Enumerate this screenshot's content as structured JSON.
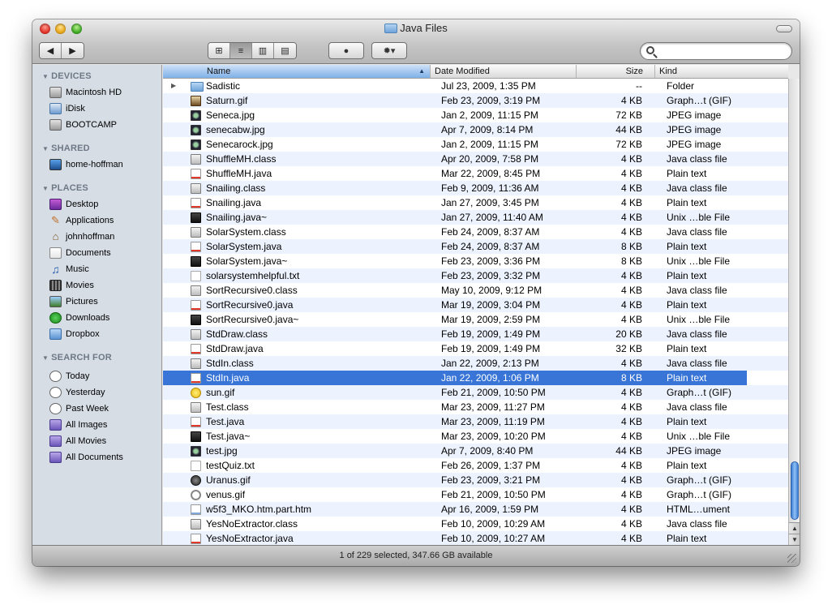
{
  "window": {
    "title": "Java Files"
  },
  "toolbar": {
    "back": "◀",
    "forward": "▶",
    "view_buttons": [
      "⊞",
      "≡",
      "▥",
      "▤"
    ],
    "eye": "●",
    "gear": "✹▾",
    "search_placeholder": ""
  },
  "sidebar": {
    "sections": [
      {
        "title": "DEVICES",
        "items": [
          {
            "label": "Macintosh HD",
            "icon": "disk"
          },
          {
            "label": "iDisk",
            "icon": "idisk"
          },
          {
            "label": "BOOTCAMP",
            "icon": "disk"
          }
        ]
      },
      {
        "title": "SHARED",
        "items": [
          {
            "label": "home-hoffman",
            "icon": "monitor"
          }
        ]
      },
      {
        "title": "PLACES",
        "items": [
          {
            "label": "Desktop",
            "icon": "desk"
          },
          {
            "label": "Applications",
            "icon": "apps"
          },
          {
            "label": "johnhoffman",
            "icon": "home"
          },
          {
            "label": "Documents",
            "icon": "docs"
          },
          {
            "label": "Music",
            "icon": "music"
          },
          {
            "label": "Movies",
            "icon": "movies"
          },
          {
            "label": "Pictures",
            "icon": "pics"
          },
          {
            "label": "Downloads",
            "icon": "dl"
          },
          {
            "label": "Dropbox",
            "icon": "box"
          }
        ]
      },
      {
        "title": "SEARCH FOR",
        "items": [
          {
            "label": "Today",
            "icon": "clock"
          },
          {
            "label": "Yesterday",
            "icon": "clock"
          },
          {
            "label": "Past Week",
            "icon": "clock"
          },
          {
            "label": "All Images",
            "icon": "smart"
          },
          {
            "label": "All Movies",
            "icon": "smart"
          },
          {
            "label": "All Documents",
            "icon": "smart"
          }
        ]
      }
    ]
  },
  "columns": {
    "name": "Name",
    "date": "Date Modified",
    "size": "Size",
    "kind": "Kind"
  },
  "files": [
    {
      "name": "Sadistic",
      "date": "Jul 23, 2009, 1:35 PM",
      "size": "--",
      "kind": "Folder",
      "icon": "folder"
    },
    {
      "name": "Saturn.gif",
      "date": "Feb 23, 2009, 3:19 PM",
      "size": "4 KB",
      "kind": "Graph…t (GIF)",
      "icon": "gif"
    },
    {
      "name": "Seneca.jpg",
      "date": "Jan 2, 2009, 11:15 PM",
      "size": "72 KB",
      "kind": "JPEG image",
      "icon": "jpg"
    },
    {
      "name": "senecabw.jpg",
      "date": "Apr 7, 2009, 8:14 PM",
      "size": "44 KB",
      "kind": "JPEG image",
      "icon": "jpg"
    },
    {
      "name": "Senecarock.jpg",
      "date": "Jan 2, 2009, 11:15 PM",
      "size": "72 KB",
      "kind": "JPEG image",
      "icon": "jpg"
    },
    {
      "name": "ShuffleMH.class",
      "date": "Apr 20, 2009, 7:58 PM",
      "size": "4 KB",
      "kind": "Java class file",
      "icon": "class"
    },
    {
      "name": "ShuffleMH.java",
      "date": "Mar 22, 2009, 8:45 PM",
      "size": "4 KB",
      "kind": "Plain text",
      "icon": "java"
    },
    {
      "name": "Snailing.class",
      "date": "Feb 9, 2009, 11:36 AM",
      "size": "4 KB",
      "kind": "Java class file",
      "icon": "class"
    },
    {
      "name": "Snailing.java",
      "date": "Jan 27, 2009, 3:45 PM",
      "size": "4 KB",
      "kind": "Plain text",
      "icon": "java"
    },
    {
      "name": "Snailing.java~",
      "date": "Jan 27, 2009, 11:40 AM",
      "size": "4 KB",
      "kind": "Unix …ble File",
      "icon": "unix"
    },
    {
      "name": "SolarSystem.class",
      "date": "Feb 24, 2009, 8:37 AM",
      "size": "4 KB",
      "kind": "Java class file",
      "icon": "class"
    },
    {
      "name": "SolarSystem.java",
      "date": "Feb 24, 2009, 8:37 AM",
      "size": "8 KB",
      "kind": "Plain text",
      "icon": "java"
    },
    {
      "name": "SolarSystem.java~",
      "date": "Feb 23, 2009, 3:36 PM",
      "size": "8 KB",
      "kind": "Unix …ble File",
      "icon": "unix"
    },
    {
      "name": "solarsystemhelpful.txt",
      "date": "Feb 23, 2009, 3:32 PM",
      "size": "4 KB",
      "kind": "Plain text",
      "icon": "text"
    },
    {
      "name": "SortRecursive0.class",
      "date": "May 10, 2009, 9:12 PM",
      "size": "4 KB",
      "kind": "Java class file",
      "icon": "class"
    },
    {
      "name": "SortRecursive0.java",
      "date": "Mar 19, 2009, 3:04 PM",
      "size": "4 KB",
      "kind": "Plain text",
      "icon": "java"
    },
    {
      "name": "SortRecursive0.java~",
      "date": "Mar 19, 2009, 2:59 PM",
      "size": "4 KB",
      "kind": "Unix …ble File",
      "icon": "unix"
    },
    {
      "name": "StdDraw.class",
      "date": "Feb 19, 2009, 1:49 PM",
      "size": "20 KB",
      "kind": "Java class file",
      "icon": "class"
    },
    {
      "name": "StdDraw.java",
      "date": "Feb 19, 2009, 1:49 PM",
      "size": "32 KB",
      "kind": "Plain text",
      "icon": "java"
    },
    {
      "name": "StdIn.class",
      "date": "Jan 22, 2009, 2:13 PM",
      "size": "4 KB",
      "kind": "Java class file",
      "icon": "class"
    },
    {
      "name": "StdIn.java",
      "date": "Jan 22, 2009, 1:06 PM",
      "size": "8 KB",
      "kind": "Plain text",
      "icon": "java",
      "selected": true
    },
    {
      "name": "sun.gif",
      "date": "Feb 21, 2009, 10:50 PM",
      "size": "4 KB",
      "kind": "Graph…t (GIF)",
      "icon": "sun"
    },
    {
      "name": "Test.class",
      "date": "Mar 23, 2009, 11:27 PM",
      "size": "4 KB",
      "kind": "Java class file",
      "icon": "class"
    },
    {
      "name": "Test.java",
      "date": "Mar 23, 2009, 11:19 PM",
      "size": "4 KB",
      "kind": "Plain text",
      "icon": "java"
    },
    {
      "name": "Test.java~",
      "date": "Mar 23, 2009, 10:20 PM",
      "size": "4 KB",
      "kind": "Unix …ble File",
      "icon": "unix"
    },
    {
      "name": "test.jpg",
      "date": "Apr 7, 2009, 8:40 PM",
      "size": "44 KB",
      "kind": "JPEG image",
      "icon": "jpg"
    },
    {
      "name": "testQuiz.txt",
      "date": "Feb 26, 2009, 1:37 PM",
      "size": "4 KB",
      "kind": "Plain text",
      "icon": "text"
    },
    {
      "name": "Uranus.gif",
      "date": "Feb 23, 2009, 3:21 PM",
      "size": "4 KB",
      "kind": "Graph…t (GIF)",
      "icon": "uranus"
    },
    {
      "name": "venus.gif",
      "date": "Feb 21, 2009, 10:50 PM",
      "size": "4 KB",
      "kind": "Graph…t (GIF)",
      "icon": "ring"
    },
    {
      "name": "w5f3_MKO.htm.part.htm",
      "date": "Apr 16, 2009, 1:59 PM",
      "size": "4 KB",
      "kind": "HTML…ument",
      "icon": "html"
    },
    {
      "name": "YesNoExtractor.class",
      "date": "Feb 10, 2009, 10:29 AM",
      "size": "4 KB",
      "kind": "Java class file",
      "icon": "class"
    },
    {
      "name": "YesNoExtractor.java",
      "date": "Feb 10, 2009, 10:27 AM",
      "size": "4 KB",
      "kind": "Plain text",
      "icon": "java"
    }
  ],
  "status": {
    "text": "1 of 229 selected, 347.66 GB available"
  }
}
